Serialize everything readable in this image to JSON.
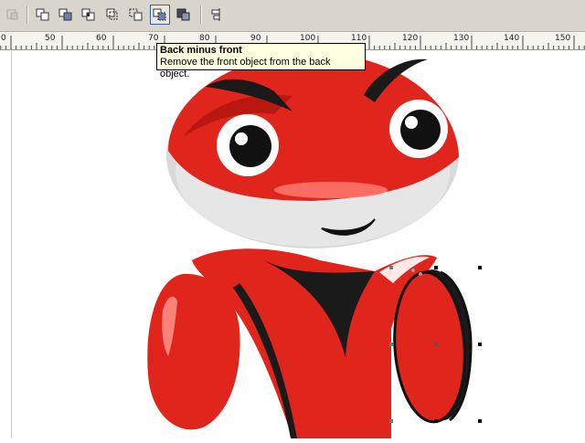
{
  "toolbar": {
    "buttons": [
      {
        "name": "weld-button",
        "icon": "weld-icon"
      },
      {
        "name": "trim-button",
        "icon": "trim-icon"
      },
      {
        "name": "intersect-button",
        "icon": "intersect-icon"
      },
      {
        "name": "simplify-button",
        "icon": "simplify-icon"
      },
      {
        "name": "front-minus-back-button",
        "icon": "front-minus-back-icon"
      },
      {
        "name": "back-minus-front-button",
        "icon": "back-minus-front-icon",
        "active": true
      },
      {
        "name": "boundary-button",
        "icon": "boundary-icon"
      },
      {
        "name": "align-distribute-button",
        "icon": "align-icon"
      }
    ]
  },
  "ruler": {
    "labels": [
      "0",
      "50",
      "60",
      "70",
      "80",
      "90",
      "100",
      "110",
      "120",
      "130",
      "140",
      "150"
    ]
  },
  "tooltip": {
    "title": "Back minus front",
    "description": "Remove the front object from the back object."
  },
  "colors": {
    "toolbar_bg": "#d8d6cc",
    "mascot_red": "#e0261c",
    "mascot_gray": "#dcdcdc",
    "tooltip_bg": "#ffffe1",
    "selection_handle": "#000000"
  }
}
